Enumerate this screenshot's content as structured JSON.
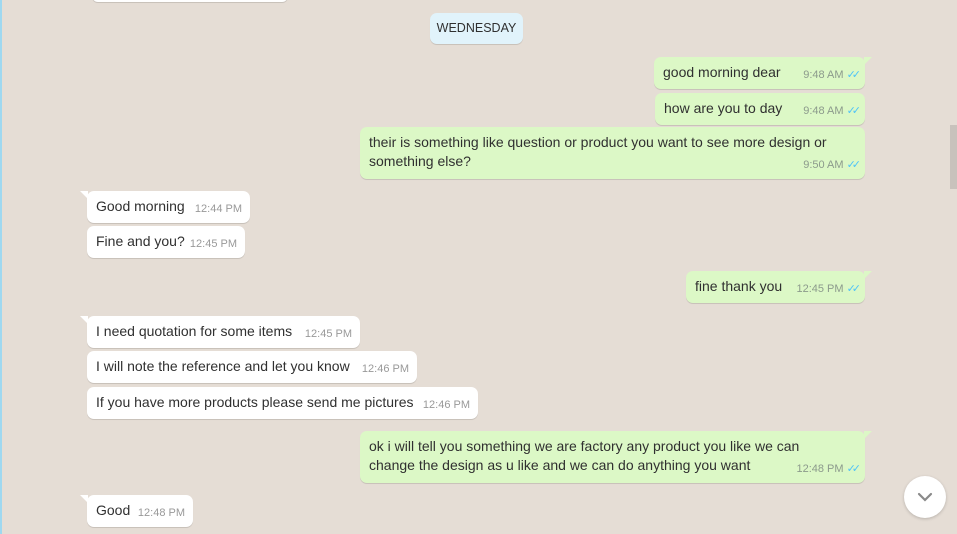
{
  "date_divider": "WEDNESDAY",
  "messages": [
    {
      "dir": "out",
      "text": "good morning dear",
      "time": "9:48 AM",
      "status": "read"
    },
    {
      "dir": "out",
      "text": "how are you to day",
      "time": "9:48 AM",
      "status": "read"
    },
    {
      "dir": "out",
      "text": "their is something like question or product you want to see more design or something else?",
      "time": "9:50 AM",
      "status": "read"
    },
    {
      "dir": "in",
      "text": "Good morning",
      "time": "12:44 PM"
    },
    {
      "dir": "in",
      "text": "Fine and you?",
      "time": "12:45 PM"
    },
    {
      "dir": "out",
      "text": "fine thank you",
      "time": "12:45 PM",
      "status": "read"
    },
    {
      "dir": "in",
      "text": "I need quotation for some items",
      "time": "12:45 PM"
    },
    {
      "dir": "in",
      "text": "I will note the reference and let you know",
      "time": "12:46 PM"
    },
    {
      "dir": "in",
      "text": "If you have more products please send me pictures",
      "time": "12:46 PM"
    },
    {
      "dir": "out",
      "text": "ok i will tell you something we are factory any product you like we can change the design as u like and we can do anything you want",
      "time": "12:48 PM",
      "status": "read"
    },
    {
      "dir": "in",
      "text": "Good",
      "time": "12:48 PM"
    }
  ],
  "colors": {
    "background": "#e5ddd5",
    "outgoing": "#dcf8c6",
    "incoming": "#ffffff",
    "read_ticks": "#4fc3f7"
  }
}
